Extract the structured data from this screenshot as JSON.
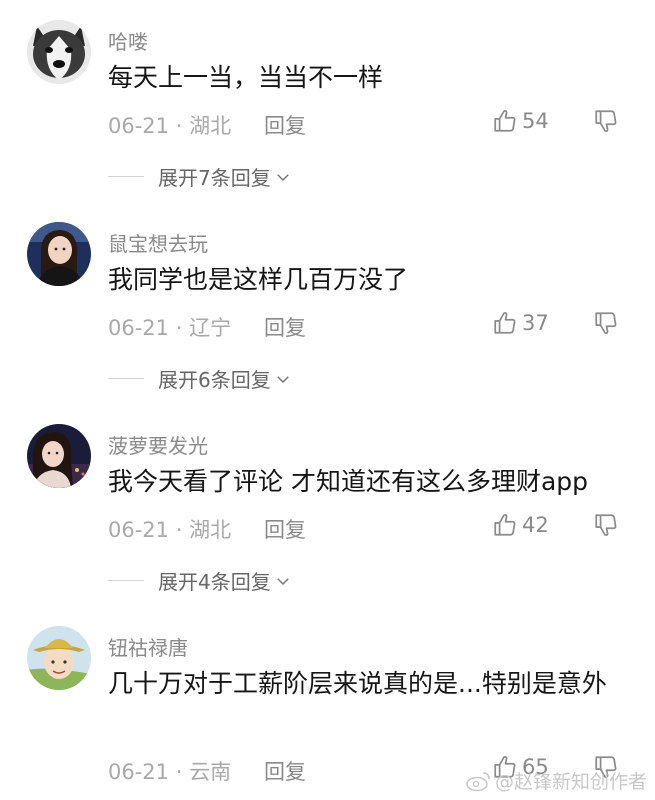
{
  "comments": [
    {
      "username": "哈喽",
      "text": "每天上一当，当当不一样",
      "date": "06-21",
      "location": "湖北",
      "reply_label": "回复",
      "likes": "54",
      "expand_label": "展开7条回复",
      "avatar_icon": "husky-dog-avatar"
    },
    {
      "username": "鼠宝想去玩",
      "text": "我同学也是这样几百万没了",
      "date": "06-21",
      "location": "辽宁",
      "reply_label": "回复",
      "likes": "37",
      "expand_label": "展开6条回复",
      "avatar_icon": "girl-portrait-avatar"
    },
    {
      "username": "菠萝要发光",
      "text": "我今天看了评论 才知道还有这么多理财app",
      "date": "06-21",
      "location": "湖北",
      "reply_label": "回复",
      "likes": "42",
      "expand_label": "展开4条回复",
      "avatar_icon": "girl-night-avatar"
    },
    {
      "username": "钮祜禄唐",
      "text": "几十万对于工薪阶层来说真的是...特别是意外",
      "date": "06-21",
      "location": "云南",
      "reply_label": "回复",
      "likes": "65",
      "avatar_icon": "cartoon-hat-avatar"
    }
  ],
  "meta_separator": "·",
  "watermark": "@赵锋新知创作者",
  "colors": {
    "username": "#8a8a8a",
    "text": "#161616",
    "meta": "#a9a9a9"
  }
}
